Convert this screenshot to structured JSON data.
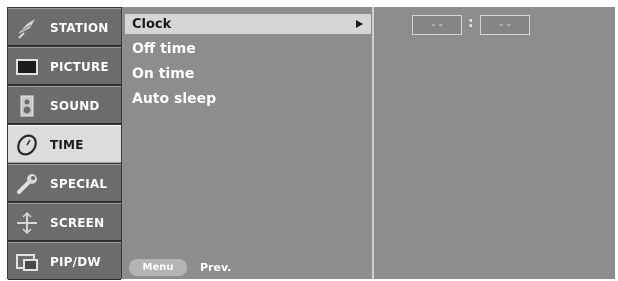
{
  "sidebar": {
    "items": [
      {
        "label": "STATION",
        "icon": "satellite-dish-icon"
      },
      {
        "label": "PICTURE",
        "icon": "picture-monitor-icon"
      },
      {
        "label": "SOUND",
        "icon": "speaker-icon"
      },
      {
        "label": "TIME",
        "icon": "clock-icon",
        "active": true
      },
      {
        "label": "SPECIAL",
        "icon": "special-wrench-icon"
      },
      {
        "label": "SCREEN",
        "icon": "screen-crosshair-icon"
      },
      {
        "label": "PIP/DW",
        "icon": "pip-window-icon"
      }
    ]
  },
  "submenu": {
    "items": [
      {
        "label": "Clock",
        "selected": true
      },
      {
        "label": "Off time"
      },
      {
        "label": "On time"
      },
      {
        "label": "Auto sleep"
      }
    ],
    "menu_button_label": "Menu",
    "prev_label": "Prev."
  },
  "clock_value": {
    "hours": "- -",
    "separator": ":",
    "minutes": "- -"
  },
  "colors": {
    "background": "#8d8d8d",
    "sidebar": "#6c6c6c",
    "active": "#dcdcdc",
    "text": "#ffffff"
  }
}
